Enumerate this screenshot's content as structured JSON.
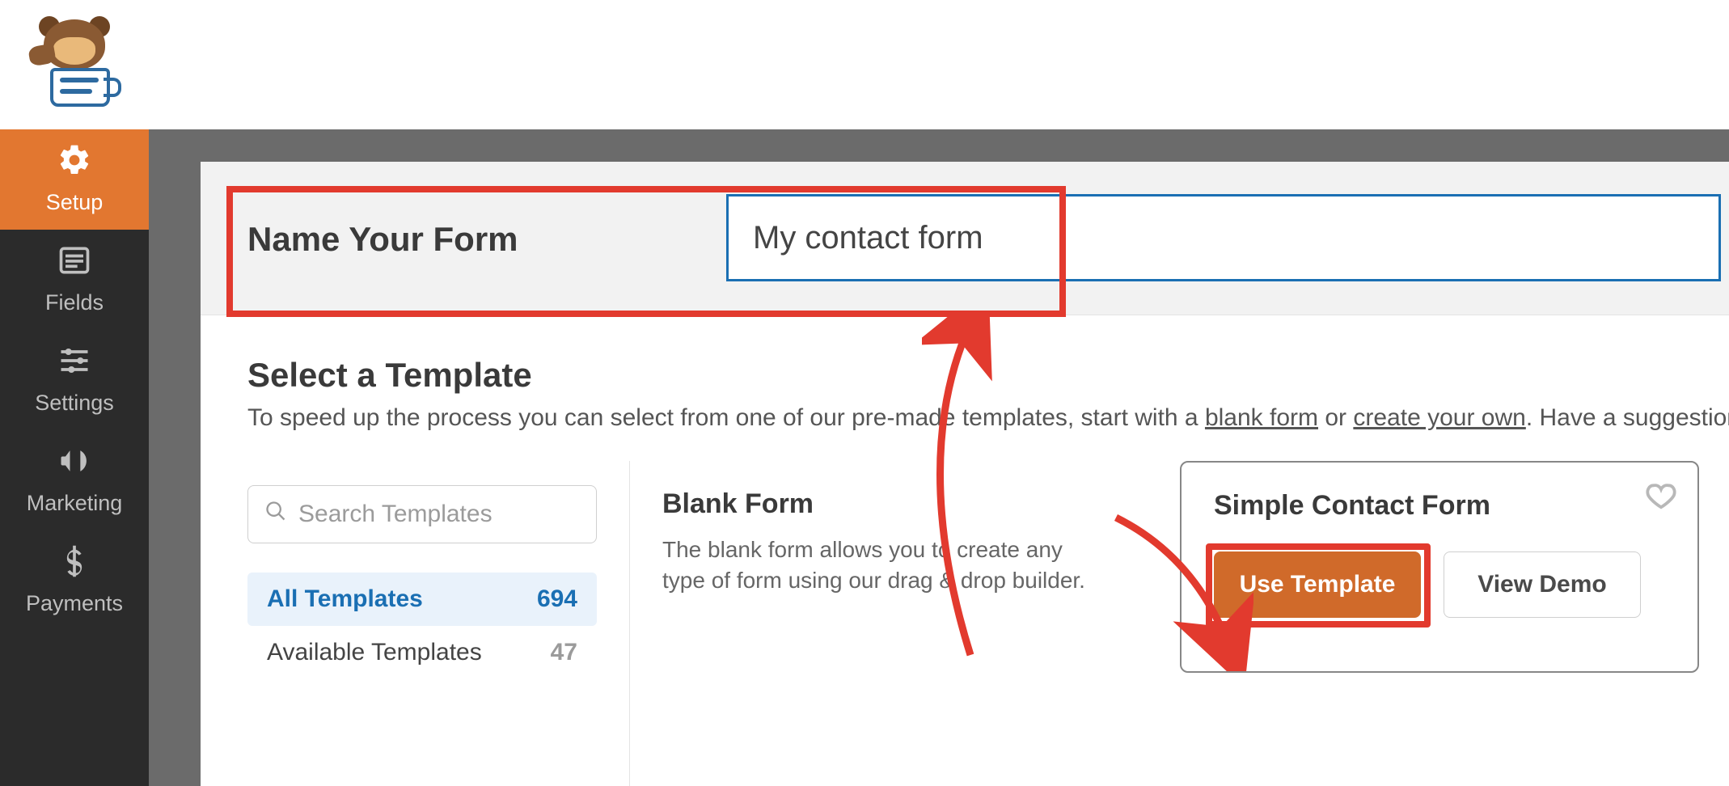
{
  "sidebar": {
    "items": [
      {
        "label": "Setup",
        "icon": "gear-icon",
        "active": true
      },
      {
        "label": "Fields",
        "icon": "list-icon",
        "active": false
      },
      {
        "label": "Settings",
        "icon": "sliders-icon",
        "active": false
      },
      {
        "label": "Marketing",
        "icon": "bullhorn-icon",
        "active": false
      },
      {
        "label": "Payments",
        "icon": "dollar-icon",
        "active": false
      }
    ]
  },
  "nameForm": {
    "label": "Name Your Form",
    "value": "My contact form"
  },
  "templates": {
    "title": "Select a Template",
    "sub_pre": "To speed up the process you can select from one of our pre-made templates, start with a ",
    "sub_link1": "blank form",
    "sub_mid": " or ",
    "sub_link2": "create your own",
    "sub_post": ". Have a suggestion fo",
    "search_placeholder": "Search Templates",
    "categories": [
      {
        "label": "All Templates",
        "count": "694",
        "active": true
      },
      {
        "label": "Available Templates",
        "count": "47",
        "active": false
      }
    ],
    "cards": {
      "blank": {
        "title": "Blank Form",
        "desc": "The blank form allows you to create any type of form using our drag & drop builder."
      },
      "simple": {
        "title": "Simple Contact Form",
        "use_label": "Use Template",
        "demo_label": "View Demo"
      }
    }
  }
}
